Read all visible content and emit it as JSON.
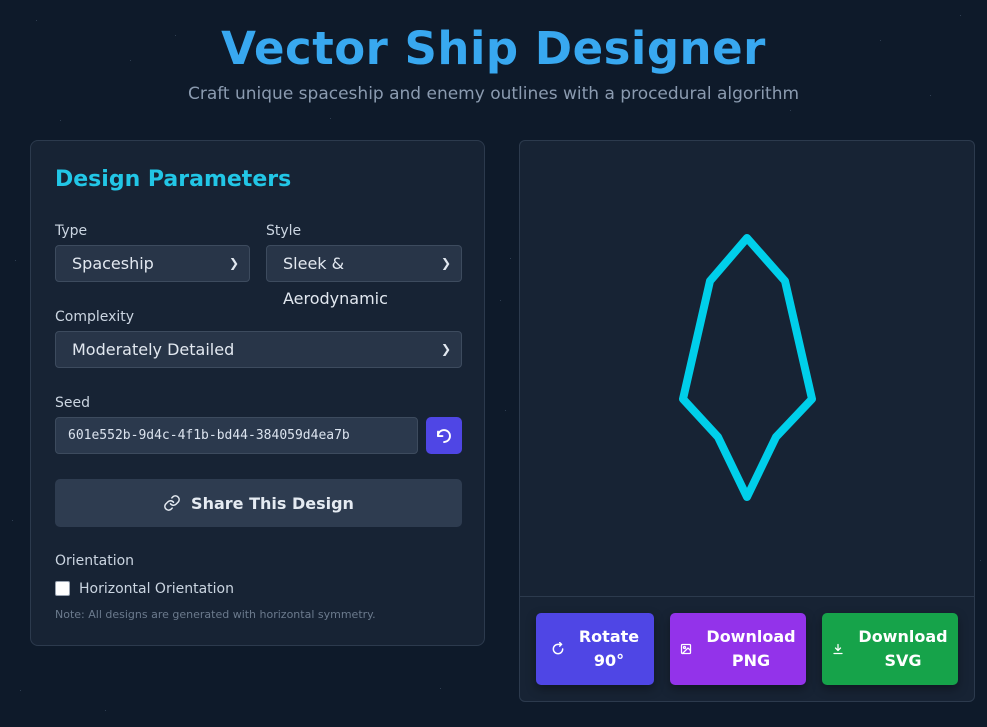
{
  "header": {
    "title": "Vector Ship Designer",
    "subtitle": "Craft unique spaceship and enemy outlines with a procedural algorithm"
  },
  "params": {
    "heading": "Design Parameters",
    "type_label": "Type",
    "type_value": "Spaceship",
    "style_label": "Style",
    "style_value": "Sleek & Aerodynamic",
    "complexity_label": "Complexity",
    "complexity_value": "Moderately Detailed",
    "seed_label": "Seed",
    "seed_value": "601e552b-9d4c-4f1b-bd44-384059d4ea7b",
    "share_label": "Share This Design",
    "orientation_label": "Orientation",
    "horizontal_label": "Horizontal Orientation",
    "horizontal_checked": false,
    "note": "Note: All designs are generated with horizontal symmetry."
  },
  "actions": {
    "rotate_line1": "Rotate",
    "rotate_line2": "90°",
    "png_line1": "Download",
    "png_line2": "PNG",
    "svg_line1": "Download",
    "svg_line2": "SVG"
  },
  "colors": {
    "accent_title": "#38a8f0",
    "accent_heading": "#22c6e6",
    "ship_stroke": "#00cfea",
    "rotate_bg": "#4f46e5",
    "png_bg": "#9333ea",
    "svg_bg": "#16a34a"
  },
  "icons": {
    "regen": "rotate-ccw-icon",
    "share": "link-icon",
    "rotate": "rotate-cw-icon",
    "png": "image-icon",
    "svg": "download-icon"
  }
}
